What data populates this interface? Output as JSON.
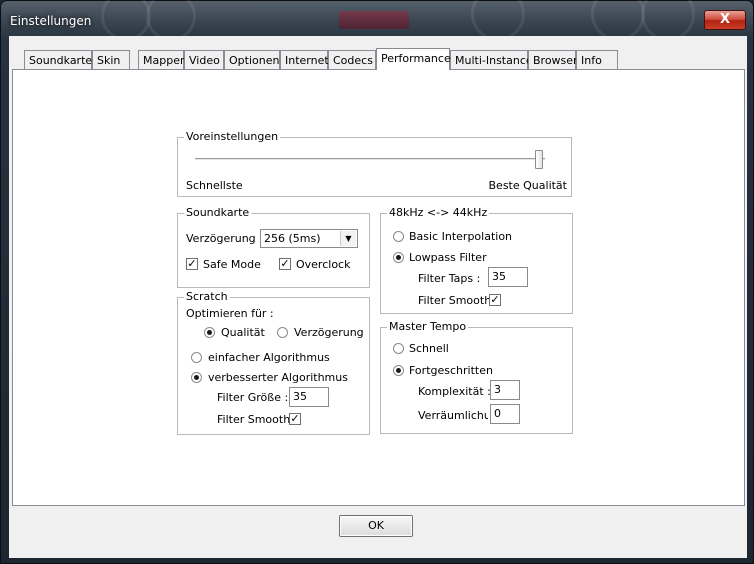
{
  "window": {
    "title": "Einstellungen",
    "close_label": "X"
  },
  "tabs": [
    {
      "label": "Soundkarten",
      "active": false
    },
    {
      "label": "Skin",
      "active": false
    },
    {
      "label": "Mapper",
      "active": false
    },
    {
      "label": "Video",
      "active": false
    },
    {
      "label": "Optionen",
      "active": false
    },
    {
      "label": "Internet",
      "active": false
    },
    {
      "label": "Codecs",
      "active": false
    },
    {
      "label": "Performance",
      "active": true
    },
    {
      "label": "Multi-Instance",
      "active": false
    },
    {
      "label": "Browser",
      "active": false
    },
    {
      "label": "Info",
      "active": false
    }
  ],
  "presets": {
    "title": "Voreinstellungen",
    "left_label": "Schnellste",
    "right_label": "Beste Qualität",
    "slider_value": 1.0
  },
  "soundcard": {
    "title": "Soundkarte",
    "delay_label": "Verzögerung :",
    "delay_value": "256 (5ms)",
    "safe_mode_label": "Safe Mode",
    "safe_mode_checked": true,
    "overclock_label": "Overclock",
    "overclock_checked": true
  },
  "scratch": {
    "title": "Scratch",
    "optimize_label": "Optimieren für :",
    "quality_label": "Qualität",
    "quality_selected": true,
    "delay_label": "Verzögerung",
    "delay_selected": false,
    "simple_algo_label": "einfacher Algorithmus",
    "simple_algo_selected": false,
    "improved_algo_label": "verbesserter Algorithmus",
    "improved_algo_selected": true,
    "filter_size_label": "Filter Größe :",
    "filter_size_value": "35",
    "filter_smooth_label": "Filter Smooth",
    "filter_smooth_checked": true
  },
  "resample": {
    "title": "48kHz <-> 44kHz",
    "basic_label": "Basic Interpolation",
    "basic_selected": false,
    "lowpass_label": "Lowpass Filter",
    "lowpass_selected": true,
    "filter_taps_label": "Filter Taps :",
    "filter_taps_value": "35",
    "filter_smooth_label": "Filter Smooth",
    "filter_smooth_checked": true
  },
  "master_tempo": {
    "title": "Master Tempo",
    "fast_label": "Schnell",
    "fast_selected": false,
    "advanced_label": "Fortgeschritten",
    "advanced_selected": true,
    "complexity_label": "Komplexität :",
    "complexity_value": "3",
    "spatial_label": "Verräumlichung",
    "spatial_value": "0"
  },
  "footer": {
    "ok_label": "OK"
  }
}
